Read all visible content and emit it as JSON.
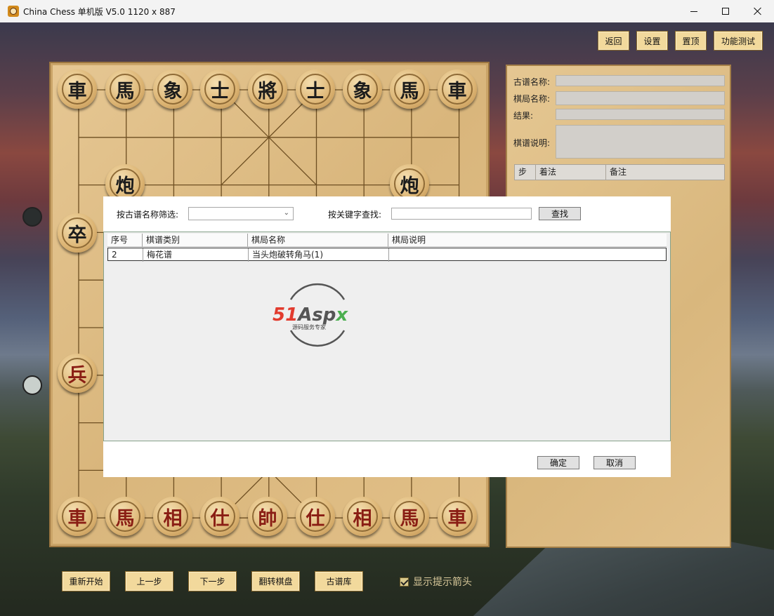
{
  "window": {
    "title": "China Chess 单机版 V5.0  1120 x 887"
  },
  "toolbar": {
    "back_label": "返回",
    "settings_label": "设置",
    "pin_label": "置顶",
    "function_test_label": "功能测试"
  },
  "board": {
    "black_back_row": [
      "車",
      "馬",
      "象",
      "士",
      "將",
      "士",
      "象",
      "馬",
      "車"
    ],
    "black_cannons": [
      "炮",
      "炮"
    ],
    "black_soldier": "卒",
    "red_soldier": "兵",
    "red_back_row": [
      "車",
      "馬",
      "相",
      "仕",
      "帥",
      "仕",
      "相",
      "馬",
      "車"
    ]
  },
  "panel": {
    "manual_name_label": "古谱名称:",
    "game_name_label": "棋局名称:",
    "result_label": "结果:",
    "description_label": "棋谱说明:",
    "moves_table": {
      "columns": [
        "步",
        "着法",
        "备注"
      ]
    }
  },
  "bottom": {
    "restart_label": "重新开始",
    "prev_label": "上一步",
    "next_label": "下一步",
    "flip_label": "翻转棋盘",
    "library_label": "古谱库",
    "show_arrow_label": "显示提示箭头",
    "show_arrow_checked": true
  },
  "dialog": {
    "filter_label": "按古谱名称筛选:",
    "filter_value": "",
    "keyword_label": "按关键字查找:",
    "keyword_value": "",
    "find_label": "查找",
    "ok_label": "确定",
    "cancel_label": "取消",
    "table": {
      "columns": [
        "序号",
        "棋谱类别",
        "棋局名称",
        "棋局说明"
      ],
      "rows": [
        [
          "2",
          "梅花谱",
          "当头炮破转角马(1)",
          ""
        ]
      ]
    },
    "watermark": {
      "brand": "51Aspx",
      "tagline": "源码服务专家"
    }
  },
  "colors": {
    "button_face": "#f2d99c",
    "board_wood": "#dcb77d",
    "red_piece_text": "#8a1e14",
    "black_piece_text": "#1c1c1c",
    "logo_red": "#e23b2e",
    "logo_green": "#4caf50"
  }
}
